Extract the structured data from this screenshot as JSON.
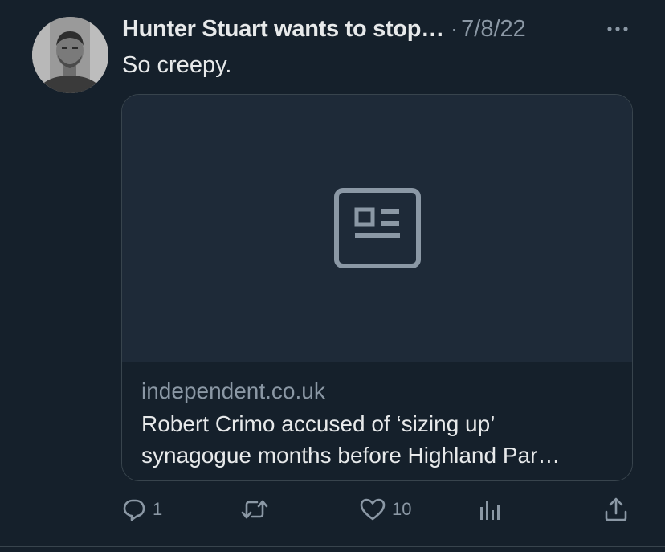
{
  "tweet": {
    "author_name": "Hunter Stuart wants to stop…",
    "separator": "·",
    "timestamp": "7/8/22",
    "text": "So creepy.",
    "card": {
      "domain": "independent.co.uk",
      "title_line1": "Robert Crimo accused of ‘sizing up’",
      "title_line2": "synagogue months before Highland Par…",
      "media_icon": "newspaper-icon"
    }
  },
  "actions": {
    "reply_count": "1",
    "retweet_count": "",
    "like_count": "10",
    "views_count": ""
  },
  "icons": {
    "more": "more-horizontal-icon",
    "reply": "reply-icon",
    "retweet": "retweet-icon",
    "like": "heart-icon",
    "views": "analytics-icon",
    "share": "share-icon"
  },
  "colors": {
    "background": "#15202b",
    "card_media_background": "#1e2a38",
    "primary_text": "#e7e9ea",
    "secondary_text": "#8b98a5",
    "border": "#38444d",
    "icon_placeholder": "#8b98a5"
  }
}
